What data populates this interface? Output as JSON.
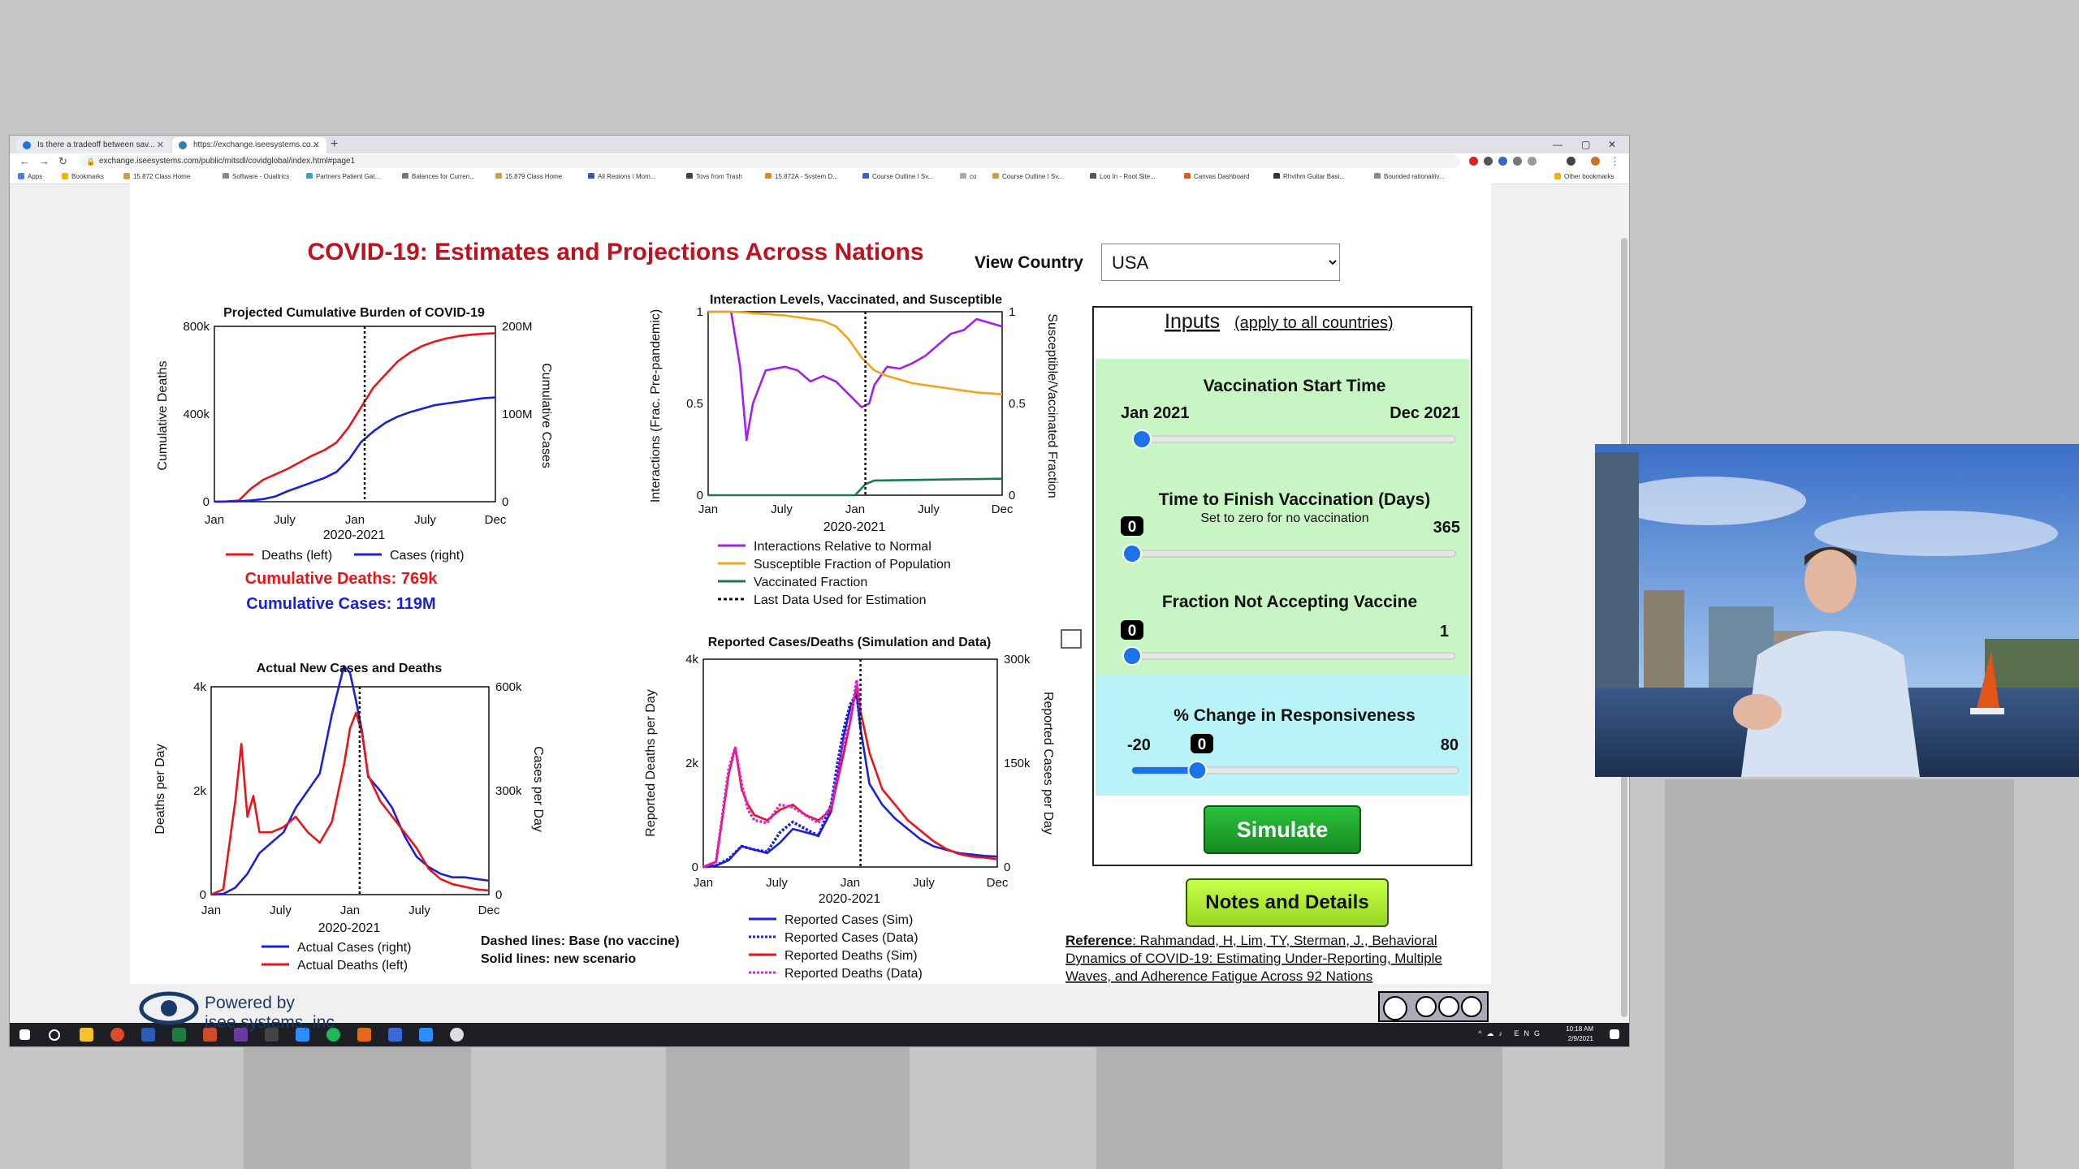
{
  "browser": {
    "tabs": [
      {
        "title": "Is there a tradeoff between sav..."
      },
      {
        "title": "https://exchange.iseesystems.co..."
      }
    ],
    "url": "exchange.iseesystems.com/public/mitsdl/covidglobal/index.html#page1",
    "bookmarks": [
      "Apps",
      "Bookmarks",
      "15.872 Class Home",
      "Software - Qualtrics",
      "Partners Patient Gat...",
      "Balances for Curren...",
      "15.879 Class Home",
      "All Regions | Mom...",
      "Toys from Trash",
      "15.872A - System D...",
      "Course Outline | Sy...",
      "co",
      "Course Outline | Sy...",
      "Log In - Root Site...",
      "Canvas Dashboard",
      "Rhythm Guitar Basi...",
      "Bounded rationality...",
      "Other bookmarks"
    ]
  },
  "app": {
    "title": "COVID-19: Estimates and Projections Across Nations",
    "view_country_label": "View Country",
    "country": "USA",
    "inputs": {
      "heading": "Inputs",
      "heading_note": "(apply to all countries)",
      "vaccination_start": {
        "label": "Vaccination Start Time",
        "min": "Jan 2021",
        "max": "Dec 2021",
        "fraction": 0.0
      },
      "time_to_finish": {
        "label": "Time to Finish Vaccination (Days)",
        "sublabel": "Set to zero for no vaccination",
        "value": "0",
        "max": "365",
        "fraction": 0.0
      },
      "fraction_not_accepting": {
        "label": "Fraction Not Accepting Vaccine",
        "value": "0",
        "max": "1",
        "fraction": 0.0
      },
      "responsiveness": {
        "label": "% Change in Responsiveness",
        "min": "-20",
        "value": "0",
        "max": "80",
        "fraction": 0.2
      }
    },
    "simulate_button": "Simulate",
    "notes_button": "Notes and Details",
    "reference": {
      "prefix": "Reference",
      "text_line1": ": Rahmandad, H, Lim, TY, Sterman, J., Behavioral",
      "text_line2": "Dynamics of COVID-19: Estimating Under-Reporting, Multiple",
      "text_line3": "Waves, and Adherence Fatigue Across 92 Nations"
    },
    "dashed_note": "Dashed lines: Base (no vaccine)",
    "solid_note": "Solid lines: new scenario",
    "powered_by": "Powered by",
    "powered_company": "isee systems, inc",
    "cumulative_deaths_text": "Cumulative Deaths: 769k",
    "cumulative_cases_text": "Cumulative Cases: 119M"
  },
  "colors": {
    "title_red": "#c0111f",
    "deaths_red": "#e8141a",
    "cases_blue": "#1a21d6",
    "interactions_purple": "#a020f0",
    "susceptible_orange": "#f5a21b",
    "vaccinated_green": "#1a7a4a",
    "slider_green": "#c8f5c4",
    "slider_cyan": "#b8f3f8",
    "simulate_green": "#1b9e2a",
    "notes_lime": "#b6f23c"
  },
  "chart_data": [
    {
      "type": "line",
      "title": "Projected Cumulative Burden of COVID-19",
      "xlabel": "2020-2021",
      "ylabel": "Cumulative Deaths",
      "ylabel_right": "Cumulative Cases",
      "xticks": [
        "Jan",
        "July",
        "Jan",
        "July",
        "Dec"
      ],
      "yticks_left": [
        "0",
        "400k",
        "800k"
      ],
      "yticks_right": [
        "0",
        "100M",
        "200M"
      ],
      "x_range_months": [
        0,
        23
      ],
      "ylim_left": [
        0,
        800000
      ],
      "ylim_right": [
        0,
        200000000
      ],
      "last_data_month": 12.3,
      "series": [
        {
          "name": "Deaths (left)",
          "axis": "left",
          "x": [
            0,
            1,
            2,
            3,
            4,
            5,
            6,
            7,
            8,
            9,
            10,
            11,
            12,
            13,
            14,
            15,
            16,
            17,
            18,
            19,
            20,
            21,
            22,
            23
          ],
          "values": [
            0,
            1000,
            5000,
            60000,
            100000,
            125000,
            150000,
            180000,
            210000,
            235000,
            270000,
            340000,
            430000,
            520000,
            580000,
            640000,
            680000,
            710000,
            730000,
            745000,
            755000,
            762000,
            766000,
            769000
          ]
        },
        {
          "name": "Cases (right)",
          "axis": "right",
          "x": [
            0,
            1,
            2,
            3,
            4,
            5,
            6,
            7,
            8,
            9,
            10,
            11,
            12,
            13,
            14,
            15,
            16,
            17,
            18,
            19,
            20,
            21,
            22,
            23
          ],
          "values": [
            0,
            200000,
            500000,
            1500000,
            3000000,
            6000000,
            12000000,
            17000000,
            22000000,
            27000000,
            34000000,
            48000000,
            68000000,
            80000000,
            90000000,
            97000000,
            102000000,
            106000000,
            110000000,
            112000000,
            114000000,
            116000000,
            118000000,
            119000000
          ]
        }
      ]
    },
    {
      "type": "line",
      "title": "Interaction Levels, Vaccinated, and Susceptible",
      "xlabel": "2020-2021",
      "ylabel": "Interactions (Frac. Pre-pandemic)",
      "ylabel_right": "Susceptible/Vaccinated Fraction",
      "xticks": [
        "Jan",
        "July",
        "Jan",
        "July",
        "Dec"
      ],
      "yticks_left": [
        "0",
        "0.5",
        "1"
      ],
      "yticks_right": [
        "0",
        "0.5",
        "1"
      ],
      "x_range_months": [
        0,
        23
      ],
      "ylim_left": [
        0,
        1
      ],
      "ylim_right": [
        0,
        1
      ],
      "last_data_month": 12.3,
      "series": [
        {
          "name": "Interactions Relative to Normal",
          "x": [
            0,
            1.8,
            2.5,
            3,
            3.5,
            4.5,
            6,
            7,
            8,
            9,
            10,
            11,
            12,
            12.6,
            13,
            14,
            15,
            16,
            17,
            18,
            19,
            20,
            21,
            22,
            23
          ],
          "values": [
            1,
            1,
            0.7,
            0.3,
            0.5,
            0.68,
            0.7,
            0.68,
            0.62,
            0.65,
            0.62,
            0.55,
            0.48,
            0.5,
            0.6,
            0.7,
            0.69,
            0.72,
            0.76,
            0.82,
            0.88,
            0.9,
            0.96,
            0.94,
            0.92
          ]
        },
        {
          "name": "Susceptible Fraction of Population",
          "x": [
            0,
            2,
            4,
            6,
            8,
            9,
            10,
            11,
            12,
            13,
            14,
            15,
            16,
            17,
            18,
            19,
            20,
            21,
            22,
            23
          ],
          "values": [
            1,
            1,
            0.99,
            0.98,
            0.96,
            0.95,
            0.92,
            0.85,
            0.75,
            0.68,
            0.65,
            0.63,
            0.61,
            0.6,
            0.59,
            0.58,
            0.57,
            0.56,
            0.555,
            0.55
          ]
        },
        {
          "name": "Vaccinated Fraction",
          "x": [
            0,
            11.5,
            12.3,
            13,
            23
          ],
          "values": [
            0,
            0,
            0.06,
            0.08,
            0.09
          ]
        },
        {
          "name": "Last Data Used for Estimation",
          "x": [
            12.3,
            12.3
          ],
          "values": [
            0,
            1
          ]
        }
      ]
    },
    {
      "type": "line",
      "title": "Actual New Cases and Deaths",
      "xlabel": "2020-2021",
      "ylabel": "Deaths per Day",
      "ylabel_right": "Cases per Day",
      "xticks": [
        "Jan",
        "July",
        "Jan",
        "July",
        "Dec"
      ],
      "yticks_left": [
        "0",
        "2k",
        "4k"
      ],
      "yticks_right": [
        "0",
        "300k",
        "600k"
      ],
      "x_range_months": [
        0,
        23
      ],
      "ylim_left": [
        0,
        4000
      ],
      "ylim_right": [
        0,
        600000
      ],
      "last_data_month": 12.3,
      "series": [
        {
          "name": "Actual Cases (right)",
          "axis": "right",
          "x": [
            0,
            1,
            2,
            3,
            4,
            5,
            6,
            7,
            8,
            9,
            10,
            11,
            11.5,
            12,
            12.5,
            13,
            14,
            15,
            16,
            17,
            18,
            19,
            20,
            21,
            22,
            23
          ],
          "values": [
            0,
            2000,
            20000,
            60000,
            120000,
            150000,
            180000,
            250000,
            300000,
            350000,
            520000,
            660000,
            640000,
            560000,
            470000,
            340000,
            300000,
            250000,
            170000,
            110000,
            80000,
            60000,
            50000,
            50000,
            45000,
            40000
          ]
        },
        {
          "name": "Actual Deaths (left)",
          "axis": "left",
          "x": [
            0,
            1,
            2,
            2.5,
            3,
            3.5,
            4,
            5,
            6,
            7,
            8,
            9,
            10,
            11,
            11.5,
            12,
            12.5,
            13,
            14,
            15,
            16,
            17,
            18,
            19,
            20,
            21,
            22,
            23
          ],
          "values": [
            0,
            100,
            1800,
            2900,
            1500,
            1900,
            1200,
            1200,
            1300,
            1500,
            1200,
            1000,
            1400,
            2500,
            3200,
            3500,
            3100,
            2300,
            1800,
            1500,
            1200,
            900,
            500,
            300,
            200,
            150,
            100,
            80
          ]
        }
      ]
    },
    {
      "type": "line",
      "title": "Reported Cases/Deaths (Simulation and Data)",
      "xlabel": "2020-2021",
      "ylabel": "Reported Deaths per Day",
      "ylabel_right": "Reported Cases per Day",
      "xticks": [
        "Jan",
        "July",
        "Jan",
        "July",
        "Dec"
      ],
      "yticks_left": [
        "0",
        "2k",
        "4k"
      ],
      "yticks_right": [
        "0",
        "150k",
        "300k"
      ],
      "x_range_months": [
        0,
        23
      ],
      "ylim_left": [
        0,
        4000
      ],
      "ylim_right": [
        0,
        300000
      ],
      "last_data_month": 12.3,
      "series": [
        {
          "name": "Reported Cases (Sim)",
          "axis": "right",
          "x": [
            0,
            1,
            2,
            3,
            4,
            5,
            6,
            7,
            8,
            9,
            10,
            10.5,
            11,
            11.5,
            12,
            12.3,
            13,
            14,
            15,
            16,
            17,
            18,
            19,
            20,
            21,
            22,
            23
          ],
          "values": [
            0,
            2000,
            10000,
            30000,
            25000,
            20000,
            35000,
            55000,
            50000,
            45000,
            80000,
            130000,
            190000,
            230000,
            250000,
            200000,
            120000,
            90000,
            70000,
            55000,
            40000,
            30000,
            25000,
            20000,
            18000,
            16000,
            15000
          ]
        },
        {
          "name": "Reported Cases (Data)",
          "axis": "right",
          "x": [
            0,
            1,
            2,
            3,
            4,
            5,
            6,
            7,
            8,
            9,
            10,
            10.5,
            11,
            11.5,
            12,
            12.3
          ],
          "values": [
            0,
            2000,
            12000,
            30000,
            25000,
            22000,
            50000,
            65000,
            55000,
            45000,
            90000,
            150000,
            200000,
            235000,
            250000,
            200000
          ]
        },
        {
          "name": "Reported Deaths (Sim)",
          "axis": "left",
          "x": [
            0,
            1,
            2,
            2.5,
            3,
            3.5,
            4,
            5,
            6,
            7,
            8,
            9,
            10,
            11,
            11.5,
            12,
            12.3,
            13,
            14,
            15,
            16,
            17,
            18,
            19,
            20,
            21,
            22,
            23
          ],
          "values": [
            0,
            100,
            1800,
            2300,
            1500,
            1200,
            1000,
            900,
            1100,
            1200,
            1000,
            900,
            1100,
            2200,
            2800,
            3500,
            3000,
            2200,
            1500,
            1200,
            900,
            700,
            500,
            350,
            250,
            200,
            180,
            150
          ]
        },
        {
          "name": "Reported Deaths (Data)",
          "axis": "left",
          "x": [
            0,
            1,
            2,
            2.5,
            3,
            3.5,
            4,
            5,
            6,
            7,
            8,
            9,
            10,
            11,
            11.5,
            12,
            12.3
          ],
          "values": [
            0,
            100,
            1900,
            2300,
            1600,
            1100,
            900,
            850,
            1200,
            1150,
            1000,
            850,
            1150,
            2400,
            2800,
            3600,
            3000
          ]
        }
      ]
    }
  ]
}
